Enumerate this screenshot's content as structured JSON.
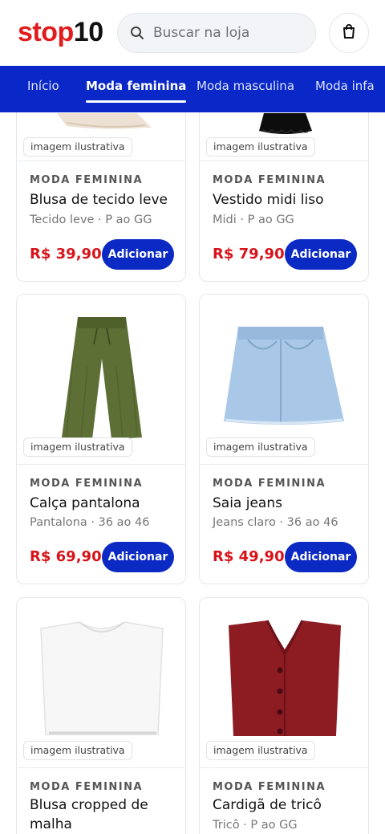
{
  "header": {
    "logo_part1": "stop",
    "logo_part2": "10",
    "search_placeholder": "Buscar na loja"
  },
  "nav": {
    "tabs": [
      {
        "label": "Início",
        "active": false
      },
      {
        "label": "Moda feminina",
        "active": true
      },
      {
        "label": "Moda masculina",
        "active": false
      },
      {
        "label": "Moda infa",
        "active": false
      }
    ]
  },
  "colors": {
    "brand_red": "#e21c1c",
    "nav_blue": "#0a28c8",
    "price_red": "#d6141a",
    "button_blue": "#0b2ac4"
  },
  "products": [
    {
      "badge": "imagem ilustrativa",
      "category": "MODA FEMININA",
      "name": "Blusa de tecido leve",
      "desc": "Tecido leve · P ao GG",
      "price": "R$ 39,90",
      "button": "Adicionar",
      "image": "folded-beige-top"
    },
    {
      "badge": "imagem ilustrativa",
      "category": "MODA FEMININA",
      "name": "Vestido midi liso",
      "desc": "Midi · P ao GG",
      "price": "R$ 79,90",
      "button": "Adicionar",
      "image": "black-dress"
    },
    {
      "badge": "imagem ilustrativa",
      "category": "MODA FEMININA",
      "name": "Calça pantalona",
      "desc": "Pantalona · 36 ao 46",
      "price": "R$ 69,90",
      "button": "Adicionar",
      "image": "green-wide-pants"
    },
    {
      "badge": "imagem ilustrativa",
      "category": "MODA FEMININA",
      "name": "Saia jeans",
      "desc": "Jeans claro · 36 ao 46",
      "price": "R$ 49,90",
      "button": "Adicionar",
      "image": "denim-skirt"
    },
    {
      "badge": "imagem ilustrativa",
      "category": "MODA FEMININA",
      "name": "Blusa cropped de malha",
      "desc": "",
      "price": "",
      "button": "",
      "image": "white-tshirt"
    },
    {
      "badge": "imagem ilustrativa",
      "category": "MODA FEMININA",
      "name": "Cardigã de tricô",
      "desc": "Tricô · P ao GG",
      "price": "",
      "button": "",
      "image": "red-cardigan"
    }
  ]
}
